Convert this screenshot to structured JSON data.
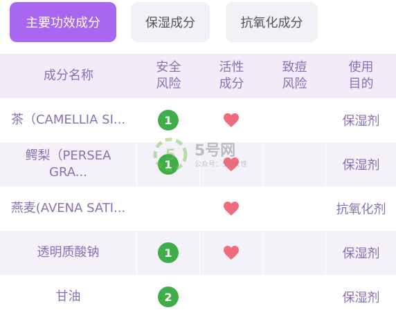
{
  "tabs": [
    {
      "label": "主要功效成分",
      "active": true
    },
    {
      "label": "保湿成分",
      "active": false
    },
    {
      "label": "抗氧化成分",
      "active": false
    }
  ],
  "table": {
    "headers": [
      "成分名称",
      "安全\n风险",
      "活性\n成分",
      "致痘\n风险",
      "使用\n目的"
    ],
    "rows": [
      {
        "name": "茶（CAMELLIA SI...",
        "risk": "1",
        "active": true,
        "acne": "",
        "purpose": "保湿剂"
      },
      {
        "name": "鳄梨（PERSEA\nGRA...",
        "risk": "1",
        "active": true,
        "acne": "",
        "purpose": "保湿剂"
      },
      {
        "name": "燕麦(AVENA SATI...",
        "risk": "",
        "active": true,
        "acne": "",
        "purpose": "抗氧化剂"
      },
      {
        "name": "透明质酸钠",
        "risk": "1",
        "active": true,
        "acne": "",
        "purpose": "保湿剂"
      },
      {
        "name": "甘油",
        "risk": "2",
        "active": false,
        "acne": "",
        "purpose": "保湿剂"
      }
    ]
  },
  "watermark": {
    "brand": "5号网",
    "sub": "公众号：5号女性"
  },
  "colors": {
    "accent": "#a966f0",
    "text": "#8a6fb3",
    "badge": "#3fae49",
    "heart": "#f06b7d",
    "header_bg": "#f1ecf8"
  }
}
